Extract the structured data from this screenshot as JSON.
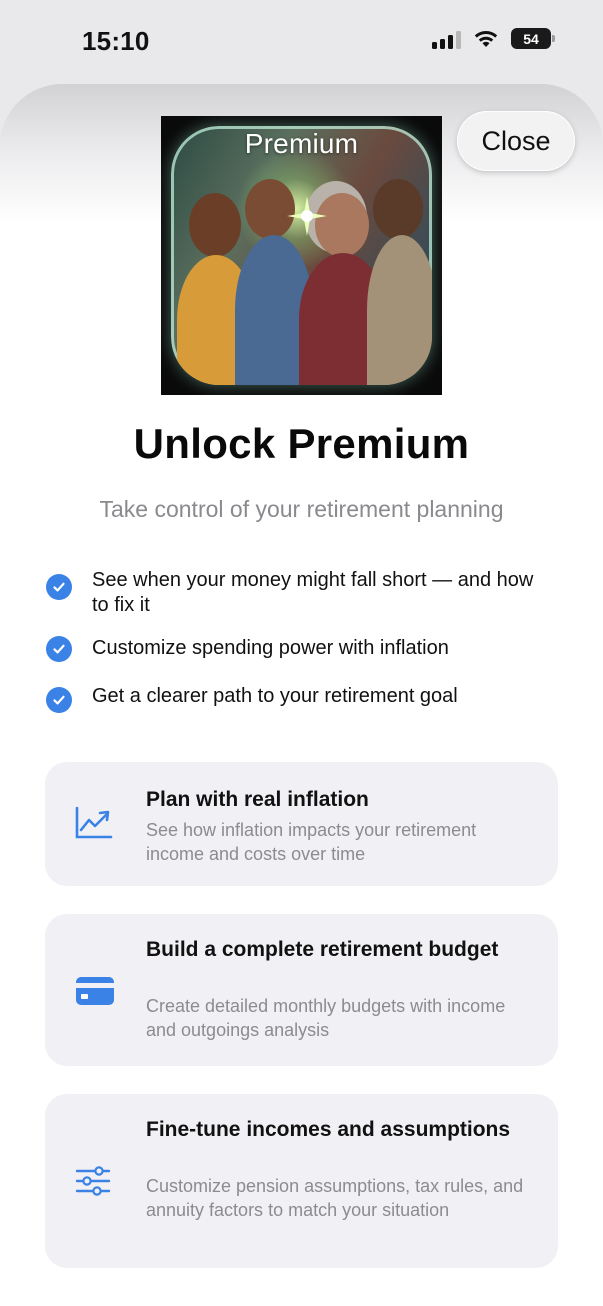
{
  "status_bar": {
    "time": "15:10",
    "battery": "54"
  },
  "hero": {
    "label": "Premium"
  },
  "close_label": "Close",
  "title": "Unlock Premium",
  "subtitle": "Take control of your retirement planning",
  "benefits": [
    "See when your money might fall short — and how to fix it",
    "Customize spending power with inflation",
    "Get a clearer path to your retirement goal"
  ],
  "features": [
    {
      "icon": "chart-line-icon",
      "title": "Plan with real inflation",
      "description": "See how inflation impacts your retirement income and costs over time"
    },
    {
      "icon": "credit-card-icon",
      "title": "Build a complete retirement budget",
      "description": "Create detailed monthly budgets with income and outgoings analysis"
    },
    {
      "icon": "sliders-icon",
      "title": "Fine-tune incomes and assumptions",
      "description": "Customize pension assumptions, tax rules, and annuity factors to match your situation"
    }
  ],
  "colors": {
    "accent": "#3b82e6",
    "card_bg": "#f1f1f5",
    "muted_text": "#8a8a8e"
  }
}
